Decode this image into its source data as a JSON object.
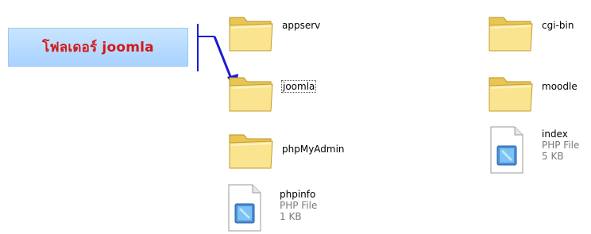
{
  "annotation": {
    "text": "โฟลเดอร์ joomla"
  },
  "items": [
    {
      "name": "appserv",
      "type": "folder"
    },
    {
      "name": "cgi-bin",
      "type": "folder"
    },
    {
      "name": "joomla",
      "type": "folder"
    },
    {
      "name": "moodle",
      "type": "folder"
    },
    {
      "name": "phpMyAdmin",
      "type": "folder"
    },
    {
      "name": "index",
      "type": "file",
      "kind": "PHP File",
      "size": "5 KB"
    },
    {
      "name": "phpinfo",
      "type": "file",
      "kind": "PHP File",
      "size": "1 KB"
    }
  ],
  "colors": {
    "annotation_text": "#d41818",
    "arrow": "#1a1ad6",
    "folder_fill": "#f6dc7a"
  }
}
